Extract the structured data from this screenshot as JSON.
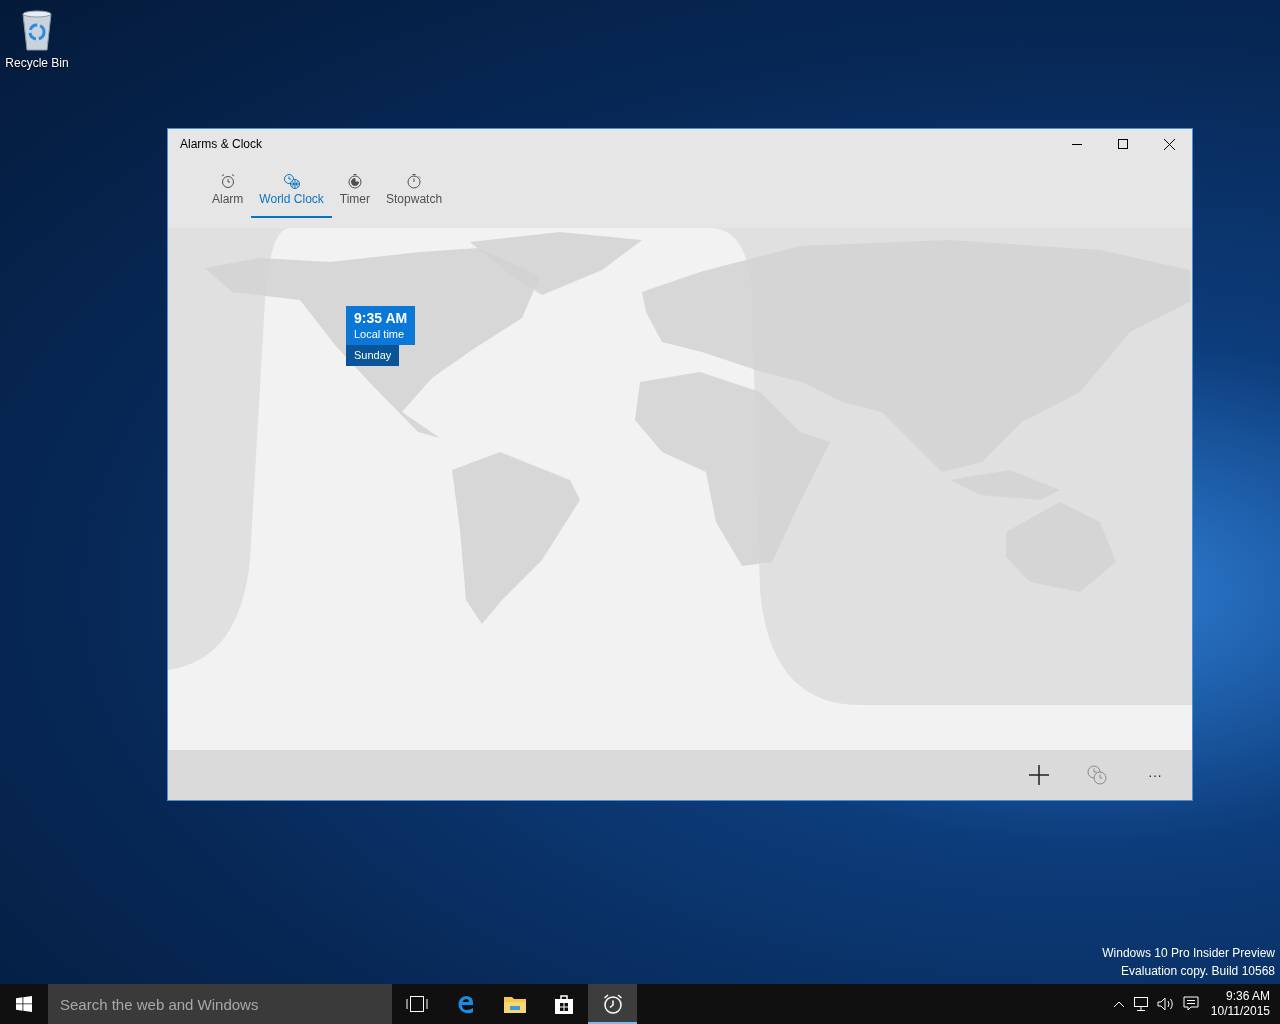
{
  "desktop_icons": [
    {
      "label": "Recycle Bin"
    }
  ],
  "window": {
    "title": "Alarms & Clock",
    "tabs": [
      {
        "kind": "alarm",
        "label": "Alarm",
        "selected": false
      },
      {
        "kind": "world-clock",
        "label": "World Clock",
        "selected": true
      },
      {
        "kind": "timer",
        "label": "Timer",
        "selected": false
      },
      {
        "kind": "stopwatch",
        "label": "Stopwatch",
        "selected": false
      }
    ],
    "city_pins": [
      {
        "time": "9:35 AM",
        "label": "Local time",
        "day": "Sunday"
      }
    ],
    "commands": [
      {
        "kind": "add"
      },
      {
        "kind": "compare"
      },
      {
        "kind": "more",
        "label": "···"
      }
    ]
  },
  "system_notice": [
    "Windows 10 Pro Insider Preview",
    "Evaluation copy. Build 10568"
  ],
  "taskbar": {
    "search": {
      "placeholder": "Search the web and Windows"
    },
    "apps": [
      {
        "kind": "task-view",
        "selected": false
      },
      {
        "kind": "edge",
        "selected": false
      },
      {
        "kind": "explorer",
        "selected": false
      },
      {
        "kind": "store",
        "selected": false
      },
      {
        "kind": "alarms",
        "selected": true
      }
    ],
    "clock": {
      "time": "9:36 AM",
      "date": "10/11/2015"
    }
  }
}
